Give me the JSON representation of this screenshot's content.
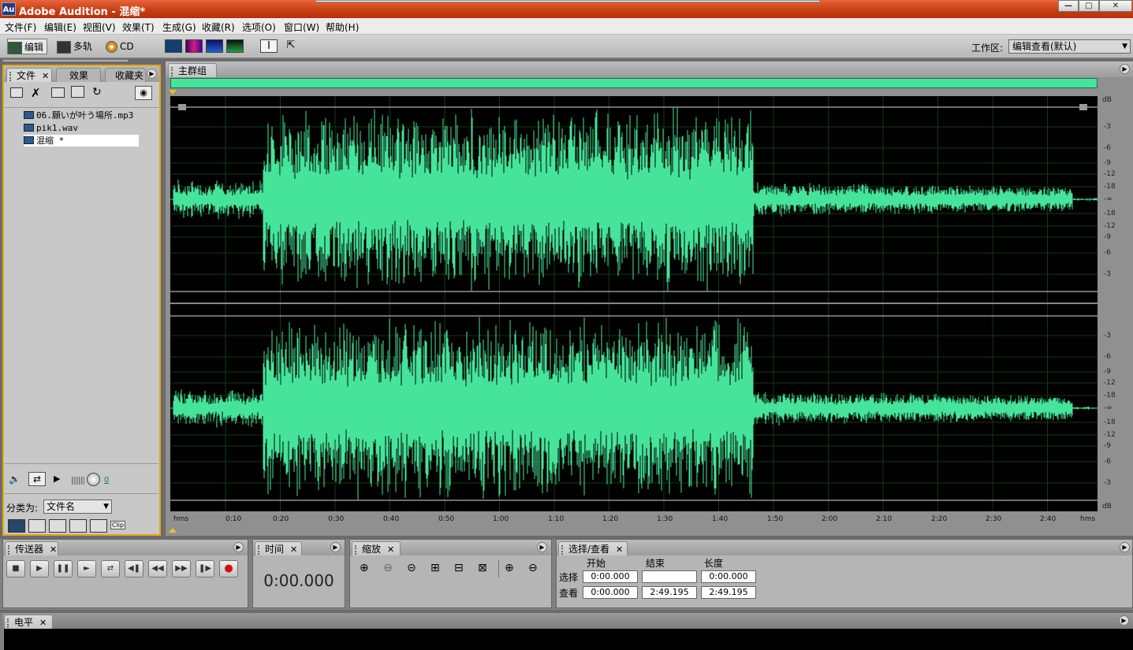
{
  "window": {
    "title": "Adobe Audition - 混缩*",
    "logo": "Au",
    "controls": [
      "minimize-icon",
      "maximize-icon",
      "close-icon"
    ]
  },
  "menu": [
    "文件(F)",
    "编辑(E)",
    "视图(V)",
    "效果(T)",
    "生成(G)",
    "收藏(R)",
    "选项(O)",
    "窗口(W)",
    "帮助(H)"
  ],
  "toolbar": {
    "edit_label": "编辑",
    "multitrack_label": "多轨",
    "cd_label": "CD",
    "workspace_label": "工作区:",
    "workspace_value": "编辑查看(默认)"
  },
  "files_panel": {
    "tabs": [
      "文件",
      "效果",
      "收藏夹"
    ],
    "files": [
      "06.願いが叶う場所.mp3",
      "pik1.wav",
      "混缩 *"
    ],
    "volume_value": "0",
    "sort_label": "分类为:",
    "sort_value": "文件名",
    "clip_btn": "Clip"
  },
  "editor": {
    "tab": "主群组",
    "db_label_top": "dB",
    "db_label_bottom": "dB",
    "db_scale": [
      "-3",
      "-6",
      "-9",
      "-12",
      "-18",
      "-∞",
      "-18",
      "-12",
      "-9",
      "-6",
      "-3"
    ],
    "time_ticks": [
      "hms",
      "0:10",
      "0:20",
      "0:30",
      "0:40",
      "0:50",
      "1:00",
      "1:10",
      "1:20",
      "1:30",
      "1:40",
      "1:50",
      "2:00",
      "2:10",
      "2:20",
      "2:30",
      "2:40",
      "hms"
    ],
    "wave_color": "#46e49a"
  },
  "transport": {
    "tab": "传送器"
  },
  "time": {
    "tab": "时间",
    "value": "0:00.000"
  },
  "zoom": {
    "tab": "缩放"
  },
  "selection": {
    "tab": "选择/查看",
    "col_start": "开始",
    "col_end": "结束",
    "col_length": "长度",
    "row_select": "选择",
    "row_view": "查看",
    "select_start": "0:00.000",
    "select_end": "",
    "select_length": "0:00.000",
    "view_start": "0:00.000",
    "view_end": "2:49.195",
    "view_length": "2:49.195"
  },
  "level": {
    "tab": "电平"
  }
}
